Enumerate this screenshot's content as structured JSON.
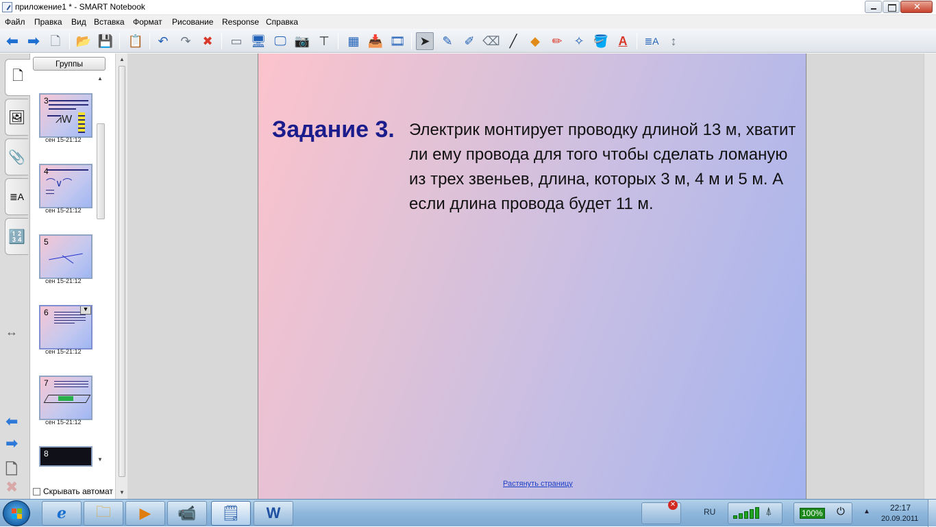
{
  "window": {
    "title": "приложение1 * - SMART Notebook"
  },
  "menu": {
    "items": [
      "Файл",
      "Правка",
      "Вид",
      "Вставка",
      "Формат",
      "Рисование",
      "Response",
      "Справка"
    ]
  },
  "toolbar": {
    "icons": [
      "back-arrow-icon",
      "forward-arrow-icon",
      "add-page-icon",
      "open-folder-icon",
      "save-icon",
      "paste-icon",
      "undo-icon",
      "redo-icon",
      "delete-icon",
      "screen-shade-icon",
      "full-screen-icon",
      "dual-page-icon",
      "screen-capture-icon",
      "document-camera-icon",
      "table-icon",
      "insert-attachment-icon",
      "record-icon",
      "select-icon",
      "pen-icon",
      "creative-pen-icon",
      "eraser-icon",
      "line-icon",
      "shape-icon",
      "magic-pen-icon",
      "shape-recognition-pen-icon",
      "fill-icon",
      "text-icon",
      "properties-icon",
      "move-toolbar-icon"
    ],
    "active_tool": "select-icon"
  },
  "sorter": {
    "groups_label": "Группы",
    "autohide_label": "Скрывать автомат",
    "pages": [
      {
        "number": "3",
        "date": "сен 15-21:12"
      },
      {
        "number": "4",
        "date": "сен 15-21:12"
      },
      {
        "number": "5",
        "date": "сен 15-21:12"
      },
      {
        "number": "6",
        "date": "сен 15-21:12"
      },
      {
        "number": "7",
        "date": "сен 15-21:12"
      },
      {
        "number": "8",
        "date": ""
      }
    ]
  },
  "page": {
    "title": "Задание 3.",
    "text": "Электрик монтирует проводку длиной 13 м, хватит ли ему провода для того чтобы сделать ломаную из трех звеньев, длина, которых 3 м,  4 м и 5 м. А если длина провода будет 11 м.",
    "stretch_link": "Растянуть страницу"
  },
  "taskbar": {
    "language": "RU",
    "battery": "100%",
    "time": "22:17",
    "date": "20.09.2011"
  }
}
